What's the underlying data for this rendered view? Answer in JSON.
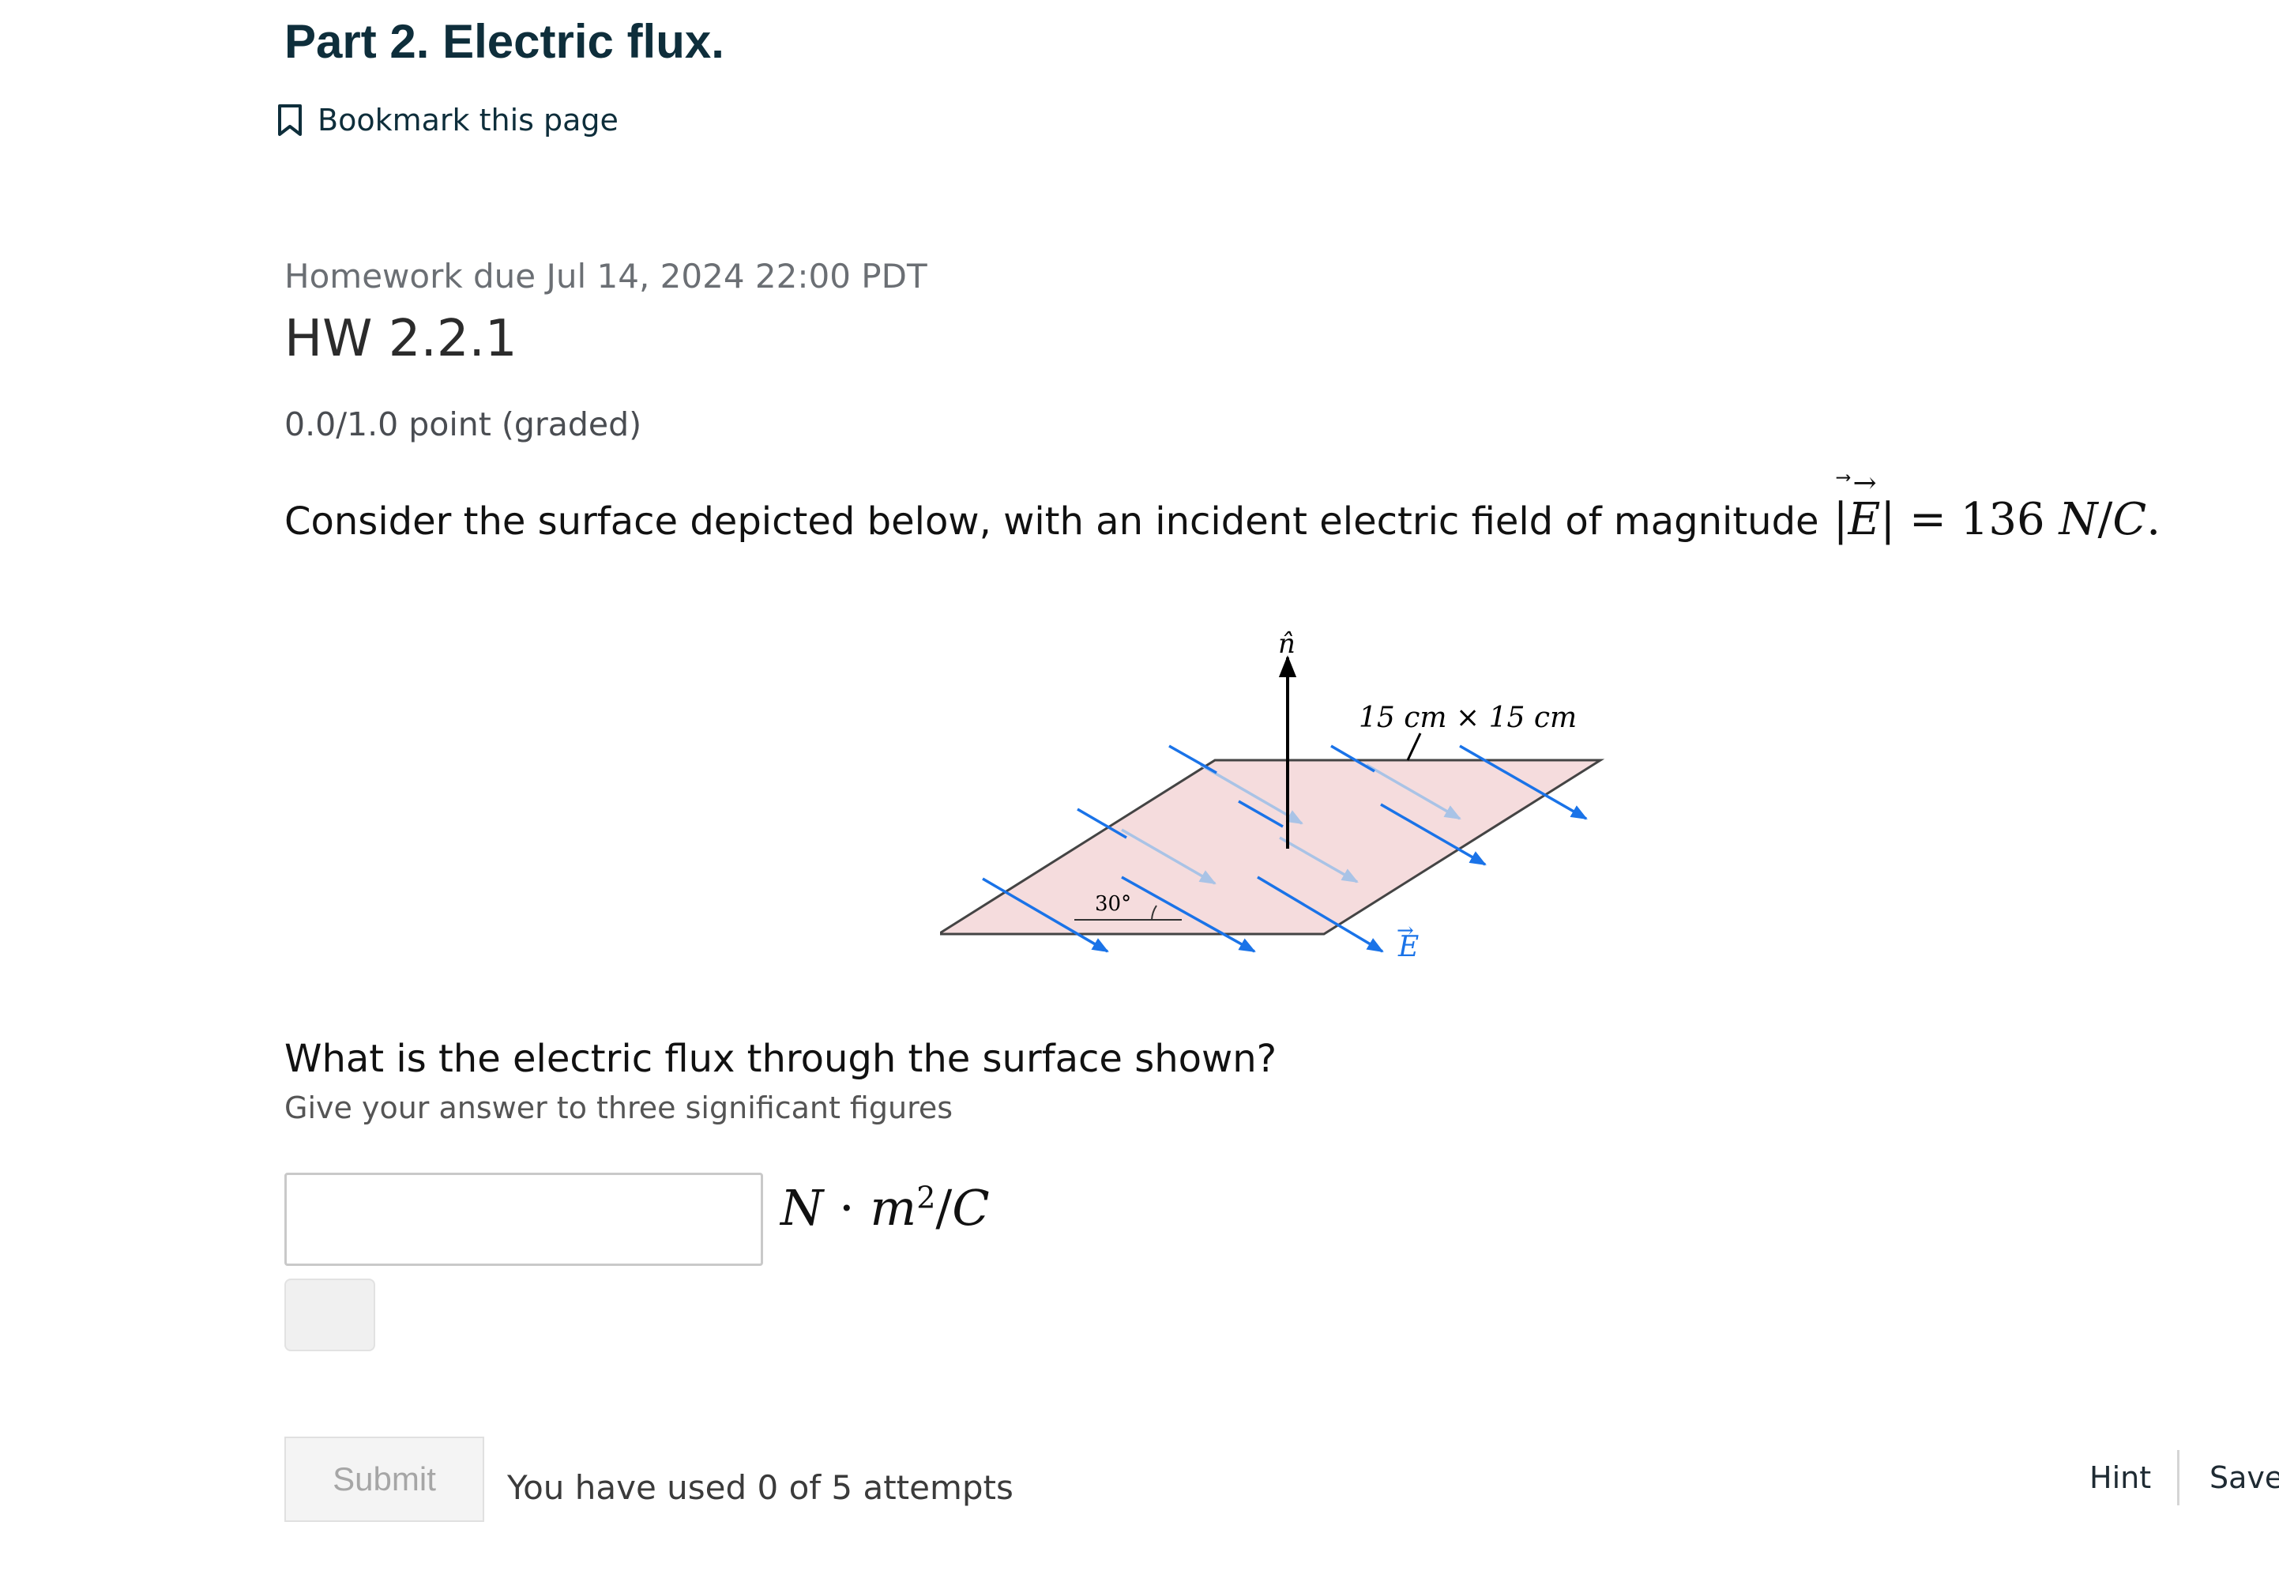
{
  "unit": {
    "title": "Part 2. Electric flux."
  },
  "bookmark": {
    "label": "Bookmark this page",
    "icon": "bookmark-icon"
  },
  "problem": {
    "due": "Homework due Jul 14, 2024 22:00 PDT",
    "title": "HW 2.2.1",
    "grade": "0.0/1.0 point (graded)",
    "statement_text": "Consider the surface depicted below, with an incident electric field of magnitude",
    "statement_math": {
      "E_symbol": "E",
      "equals": "=",
      "value": "136",
      "unit_N": "N",
      "slash": "/",
      "unit_C": "C",
      "period": "."
    },
    "figure": {
      "normal_label": "n̂",
      "size_label": "15 cm × 15 cm",
      "angle_label": "30°",
      "field_label": "E",
      "plane_color": "#f5dcdd",
      "arrow_color": "#1a73e8",
      "arrow_faded_color": "#a9c3e6"
    },
    "question": "What is the electric flux through the surface shown?",
    "instruction": "Give your answer to three significant figures",
    "answer": {
      "value": "",
      "placeholder": ""
    },
    "units": {
      "N": "N",
      "dot": "·",
      "m": "m",
      "exp": "2",
      "slash": "/",
      "C": "C"
    }
  },
  "actions": {
    "submit": "Submit",
    "attempts": "You have used 0 of 5 attempts",
    "hint": "Hint",
    "save": "Save"
  }
}
